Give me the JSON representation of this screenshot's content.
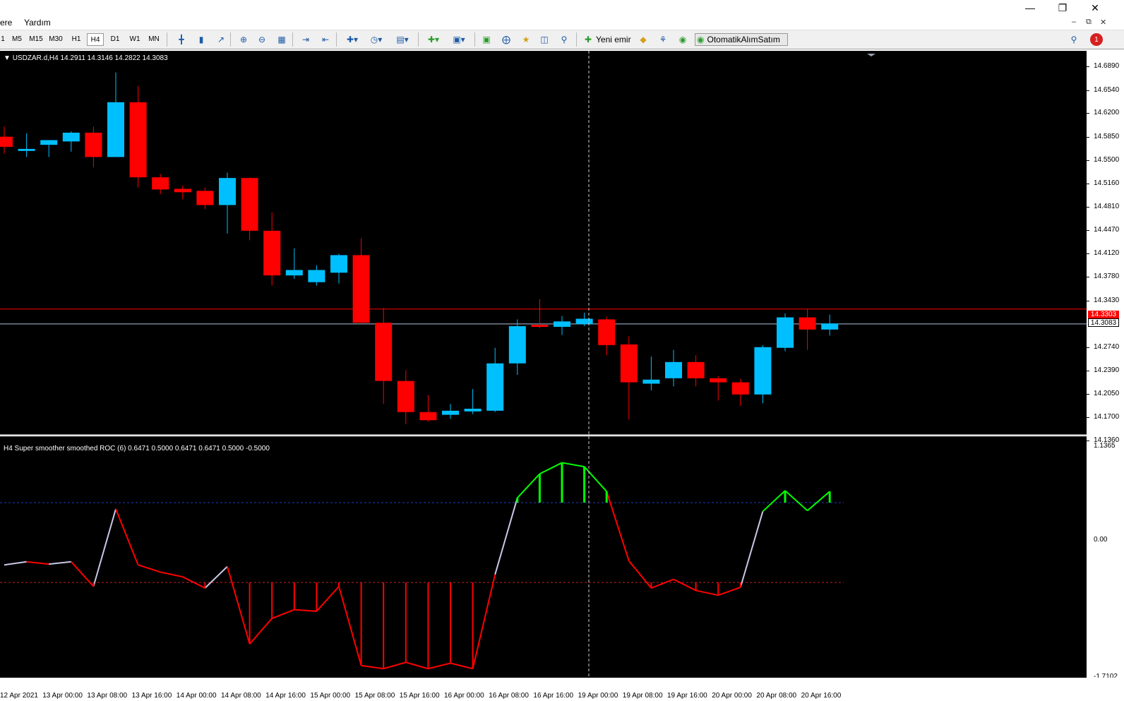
{
  "menu": {
    "items": [
      "ere",
      "Yardım"
    ]
  },
  "toolbar": {
    "timeframes": [
      "1",
      "M5",
      "M15",
      "M30",
      "H1",
      "H4",
      "D1",
      "W1",
      "MN"
    ],
    "active_timeframe": "H4",
    "new_order_label": "Yeni emir",
    "autotrading_label": "OtomatikAlımSatım",
    "notification_count": "1"
  },
  "chart": {
    "info_line": "USDZAR.d,H4  14.2911 14.3146 14.2822 14.3083",
    "current_price": "14.3083",
    "ask_price": "14.3303",
    "indicator_info": "H4 Super smoother smoothed ROC (6) 0.6471 0.5000 0.6471 0.6471 0.5000 -0.5000",
    "colors": {
      "bull": "#00bfff",
      "bear": "#ff0000",
      "up": "#00ff00",
      "neutral": "#c8c8e8",
      "bg": "#000000"
    }
  },
  "price_scale": [
    "14.6890",
    "14.6540",
    "14.6200",
    "14.5850",
    "14.5500",
    "14.5160",
    "14.4810",
    "14.4470",
    "14.4120",
    "14.3780",
    "14.3430",
    "14.2740",
    "14.2390",
    "14.2050",
    "14.1700",
    "14.1360"
  ],
  "indicator_scale": [
    "1.1365",
    "0.00",
    "-1.7102"
  ],
  "time_labels": [
    "12 Apr 2021",
    "13 Apr 00:00",
    "13 Apr 08:00",
    "13 Apr 16:00",
    "14 Apr 00:00",
    "14 Apr 08:00",
    "14 Apr 16:00",
    "15 Apr 00:00",
    "15 Apr 08:00",
    "15 Apr 16:00",
    "16 Apr 00:00",
    "16 Apr 08:00",
    "16 Apr 16:00",
    "19 Apr 00:00",
    "19 Apr 08:00",
    "19 Apr 16:00",
    "20 Apr 00:00",
    "20 Apr 08:00",
    "20 Apr 16:00"
  ],
  "chart_data": {
    "type": "candlestick",
    "symbol": "USDZAR.d",
    "timeframe": "H4",
    "ylim": [
      14.136,
      14.695
    ],
    "candles": [
      {
        "o": 14.585,
        "h": 14.6,
        "l": 14.56,
        "c": 14.57
      },
      {
        "o": 14.564,
        "h": 14.59,
        "l": 14.555,
        "c": 14.567
      },
      {
        "o": 14.573,
        "h": 14.58,
        "l": 14.555,
        "c": 14.58
      },
      {
        "o": 14.578,
        "h": 14.593,
        "l": 14.563,
        "c": 14.591
      },
      {
        "o": 14.591,
        "h": 14.6,
        "l": 14.54,
        "c": 14.555
      },
      {
        "o": 14.555,
        "h": 14.68,
        "l": 14.555,
        "c": 14.636
      },
      {
        "o": 14.636,
        "h": 14.66,
        "l": 14.51,
        "c": 14.525
      },
      {
        "o": 14.525,
        "h": 14.53,
        "l": 14.5,
        "c": 14.507
      },
      {
        "o": 14.508,
        "h": 14.513,
        "l": 14.493,
        "c": 14.503
      },
      {
        "o": 14.505,
        "h": 14.51,
        "l": 14.478,
        "c": 14.484
      },
      {
        "o": 14.484,
        "h": 14.532,
        "l": 14.442,
        "c": 14.524
      },
      {
        "o": 14.524,
        "h": 14.525,
        "l": 14.432,
        "c": 14.446
      },
      {
        "o": 14.446,
        "h": 14.473,
        "l": 14.365,
        "c": 14.38
      },
      {
        "o": 14.38,
        "h": 14.42,
        "l": 14.375,
        "c": 14.388
      },
      {
        "o": 14.37,
        "h": 14.395,
        "l": 14.365,
        "c": 14.388
      },
      {
        "o": 14.384,
        "h": 14.412,
        "l": 14.368,
        "c": 14.41
      },
      {
        "o": 14.41,
        "h": 14.435,
        "l": 14.31,
        "c": 14.31
      },
      {
        "o": 14.31,
        "h": 14.332,
        "l": 14.19,
        "c": 14.224
      },
      {
        "o": 14.224,
        "h": 14.24,
        "l": 14.16,
        "c": 14.178
      },
      {
        "o": 14.178,
        "h": 14.203,
        "l": 14.164,
        "c": 14.166
      },
      {
        "o": 14.174,
        "h": 14.19,
        "l": 14.168,
        "c": 14.18
      },
      {
        "o": 14.179,
        "h": 14.212,
        "l": 14.175,
        "c": 14.183
      },
      {
        "o": 14.18,
        "h": 14.273,
        "l": 14.178,
        "c": 14.25
      },
      {
        "o": 14.25,
        "h": 14.315,
        "l": 14.233,
        "c": 14.305
      },
      {
        "o": 14.307,
        "h": 14.345,
        "l": 14.302,
        "c": 14.304
      },
      {
        "o": 14.304,
        "h": 14.32,
        "l": 14.292,
        "c": 14.312
      },
      {
        "o": 14.308,
        "h": 14.325,
        "l": 14.305,
        "c": 14.316
      },
      {
        "o": 14.315,
        "h": 14.319,
        "l": 14.262,
        "c": 14.277
      },
      {
        "o": 14.278,
        "h": 14.29,
        "l": 14.167,
        "c": 14.222
      },
      {
        "o": 14.22,
        "h": 14.26,
        "l": 14.21,
        "c": 14.226
      },
      {
        "o": 14.228,
        "h": 14.27,
        "l": 14.216,
        "c": 14.252
      },
      {
        "o": 14.252,
        "h": 14.262,
        "l": 14.216,
        "c": 14.228
      },
      {
        "o": 14.228,
        "h": 14.231,
        "l": 14.195,
        "c": 14.222
      },
      {
        "o": 14.222,
        "h": 14.227,
        "l": 14.187,
        "c": 14.204
      },
      {
        "o": 14.204,
        "h": 14.277,
        "l": 14.191,
        "c": 14.274
      },
      {
        "o": 14.273,
        "h": 14.324,
        "l": 14.268,
        "c": 14.318
      },
      {
        "o": 14.318,
        "h": 14.33,
        "l": 14.27,
        "c": 14.3
      },
      {
        "o": 14.3,
        "h": 14.322,
        "l": 14.291,
        "c": 14.309
      }
    ],
    "indicator": {
      "name": "Super smoother smoothed ROC (6)",
      "ylim": [
        -1.7102,
        1.1365
      ],
      "levels": [
        0.5,
        -0.5
      ],
      "values": [
        -0.28,
        -0.24,
        -0.27,
        -0.24,
        -0.55,
        0.42,
        -0.28,
        -0.37,
        -0.43,
        -0.57,
        -0.3,
        -1.27,
        -0.95,
        -0.84,
        -0.86,
        -0.55,
        -1.54,
        -1.58,
        -1.5,
        -1.58,
        -1.51,
        -1.58,
        -0.4,
        0.56,
        0.86,
        1.0,
        0.95,
        0.64,
        -0.23,
        -0.57,
        -0.46,
        -0.6,
        -0.66,
        -0.56,
        0.39,
        0.65,
        0.4,
        0.64
      ]
    }
  }
}
